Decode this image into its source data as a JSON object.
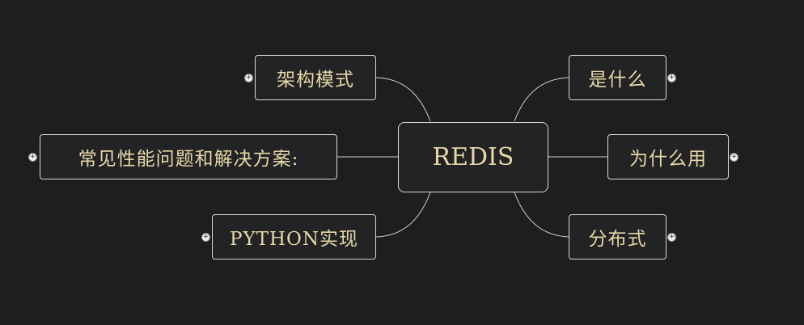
{
  "mindmap": {
    "root": {
      "label": "REDIS"
    },
    "left_topics": [
      {
        "id": "architecture",
        "label": "架构模式",
        "expander": "+"
      },
      {
        "id": "problems",
        "label": "常见性能问题和解决方案:",
        "expander": "+"
      },
      {
        "id": "python",
        "label": "PYTHON实现",
        "expander": "+"
      }
    ],
    "right_topics": [
      {
        "id": "what",
        "label": "是什么",
        "expander": "+"
      },
      {
        "id": "why",
        "label": "为什么用",
        "expander": "+"
      },
      {
        "id": "distributed",
        "label": "分布式",
        "expander": "+"
      }
    ]
  },
  "colors": {
    "background": "#1e1e20",
    "node_fill": "#232325",
    "node_border": "#d8d8d8",
    "text": "#e7d8a6",
    "connector": "#cfcfcf"
  },
  "icons": {
    "expander": "plus-circle-icon"
  }
}
